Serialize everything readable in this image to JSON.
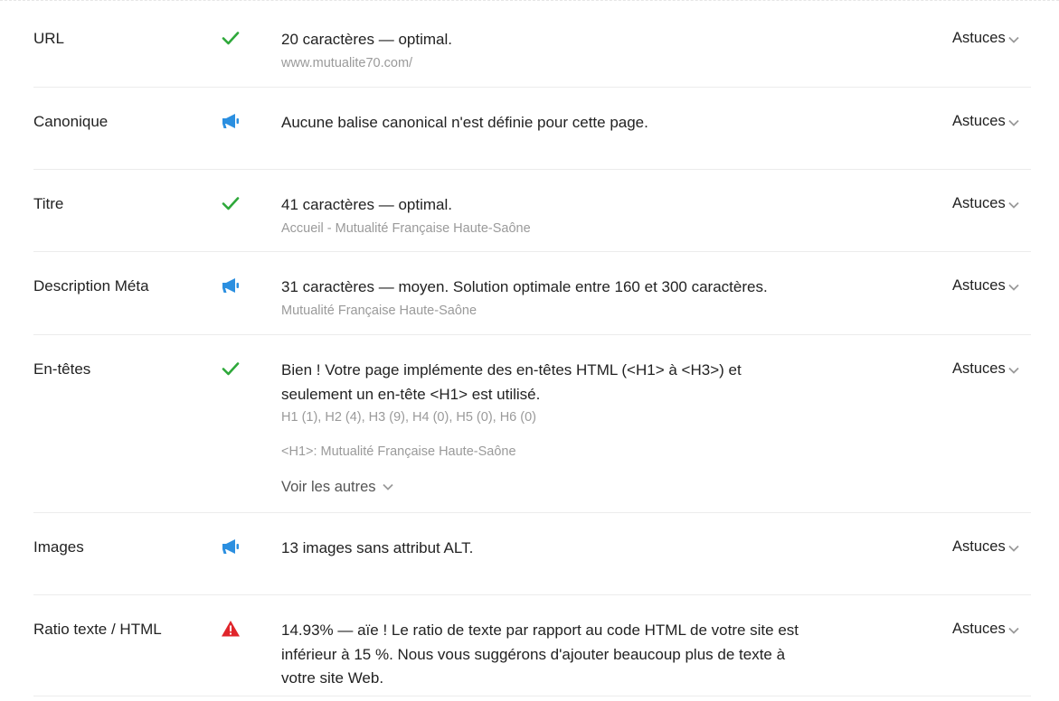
{
  "tips_label": "Astuces",
  "status_colors": {
    "ok": "#2ea83a",
    "info": "#2b8fe0",
    "warning": "#e0252b"
  },
  "rows": [
    {
      "label": "URL",
      "status": "check-icon",
      "message": "20 caractères — optimal.",
      "sub": "www.mutualite70.com/"
    },
    {
      "label": "Canonique",
      "status": "megaphone-icon",
      "message": "Aucune balise canonical n'est définie pour cette page."
    },
    {
      "label": "Titre",
      "status": "check-icon",
      "message": "41 caractères — optimal.",
      "sub": "Accueil - Mutualité Française Haute-Saône"
    },
    {
      "label": "Description Méta",
      "status": "megaphone-icon",
      "message": "31 caractères — moyen. Solution optimale entre 160 et 300 caractères.",
      "sub": "Mutualité Française Haute-Saône"
    },
    {
      "label": "En-têtes",
      "status": "check-icon",
      "message_lines": [
        "Bien ! Votre page implémente des en-têtes HTML (<H1> à <H3>) et",
        "seulement un en-tête <H1> est utilisé."
      ],
      "sub": "H1 (1), H2 (4), H3 (9), H4 (0), H5 (0), H6 (0)",
      "sub2": "<H1>: Mutualité Française Haute-Saône",
      "more_label": "Voir les autres"
    },
    {
      "label": "Images",
      "status": "megaphone-icon",
      "message": "13 images sans attribut ALT."
    },
    {
      "label": "Ratio texte / HTML",
      "status": "warning-icon",
      "message_lines": [
        "14.93% — aïe ! Le ratio de texte par rapport au code HTML de votre site est",
        "inférieur à 15 %. Nous vous suggérons d'ajouter beaucoup plus de texte à",
        "votre site Web."
      ]
    }
  ]
}
